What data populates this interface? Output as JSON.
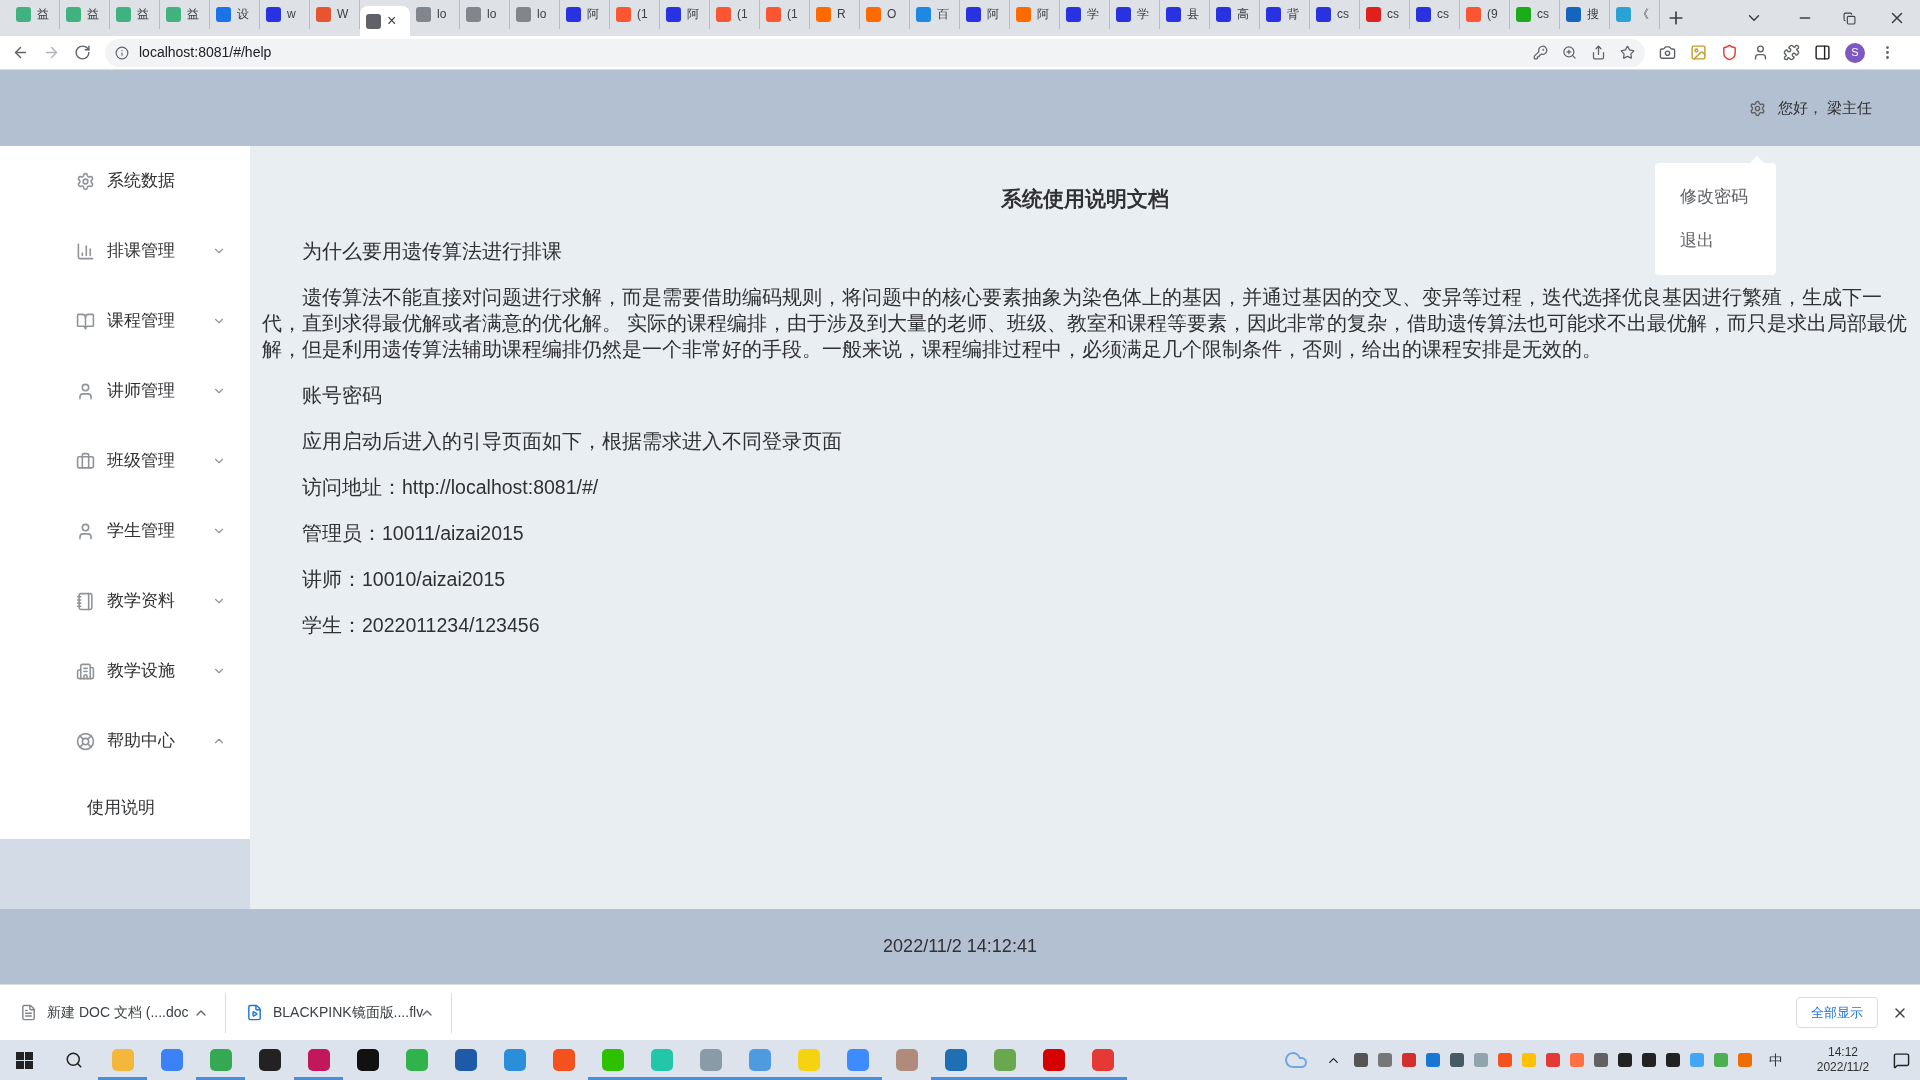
{
  "browser": {
    "tabs": [
      {
        "title": "益",
        "color": "#3fb27f",
        "selected": false
      },
      {
        "title": "益",
        "color": "#3fb27f",
        "selected": false
      },
      {
        "title": "益",
        "color": "#3fb27f",
        "selected": false
      },
      {
        "title": "益",
        "color": "#3fb27f",
        "selected": false
      },
      {
        "title": "设",
        "color": "#1a73e8",
        "selected": false
      },
      {
        "title": "w",
        "color": "#2932e1",
        "selected": false
      },
      {
        "title": "W",
        "color": "#e8542f",
        "selected": false
      },
      {
        "color": "#5f6368",
        "selected": true,
        "close": "×"
      },
      {
        "title": "lo",
        "color": "#80868b",
        "selected": false
      },
      {
        "title": "lo",
        "color": "#80868b",
        "selected": false
      },
      {
        "title": "lo",
        "color": "#80868b",
        "selected": false
      },
      {
        "title": "阿",
        "color": "#2932e1",
        "selected": false
      },
      {
        "title": "(1",
        "color": "#fc5531",
        "selected": false
      },
      {
        "title": "阿",
        "color": "#2932e1",
        "selected": false
      },
      {
        "title": "(1",
        "color": "#fc5531",
        "selected": false
      },
      {
        "title": "(1",
        "color": "#fc5531",
        "selected": false
      },
      {
        "title": "R",
        "color": "#ff6a00",
        "selected": false
      },
      {
        "title": "O",
        "color": "#ff6a00",
        "selected": false
      },
      {
        "title": "百",
        "color": "#1e88e5",
        "selected": false
      },
      {
        "title": "阿",
        "color": "#2932e1",
        "selected": false
      },
      {
        "title": "阿",
        "color": "#ff6a00",
        "selected": false
      },
      {
        "title": "学",
        "color": "#2932e1",
        "selected": false
      },
      {
        "title": "学",
        "color": "#2932e1",
        "selected": false
      },
      {
        "title": "县",
        "color": "#2932e1",
        "selected": false
      },
      {
        "title": "高",
        "color": "#2932e1",
        "selected": false
      },
      {
        "title": "背",
        "color": "#2932e1",
        "selected": false
      },
      {
        "title": "cs",
        "color": "#2932e1",
        "selected": false
      },
      {
        "title": "cs",
        "color": "#e01f1f",
        "selected": false
      },
      {
        "title": "cs",
        "color": "#2932e1",
        "selected": false
      },
      {
        "title": "(9",
        "color": "#fc5531",
        "selected": false
      },
      {
        "title": "cs",
        "color": "#1aad19",
        "selected": false
      },
      {
        "title": "搜",
        "color": "#1565c0",
        "selected": false
      },
      {
        "title": "《",
        "color": "#29a3d6",
        "selected": false
      }
    ],
    "address": "localhost:8081/#/help",
    "profile": "S"
  },
  "header": {
    "greeting": "您好， 梁主任"
  },
  "user_menu": [
    "修改密码",
    "退出"
  ],
  "sidebar": {
    "items": [
      {
        "label": "系统数据",
        "kind": "link"
      },
      {
        "label": "排课管理",
        "kind": "group",
        "expanded": false
      },
      {
        "label": "课程管理",
        "kind": "group",
        "expanded": false
      },
      {
        "label": "讲师管理",
        "kind": "group",
        "expanded": false
      },
      {
        "label": "班级管理",
        "kind": "group",
        "expanded": false
      },
      {
        "label": "学生管理",
        "kind": "group",
        "expanded": false
      },
      {
        "label": "教学资料",
        "kind": "group",
        "expanded": false
      },
      {
        "label": "教学设施",
        "kind": "group",
        "expanded": false
      },
      {
        "label": "帮助中心",
        "kind": "group",
        "expanded": true,
        "children": [
          {
            "label": "使用说明"
          }
        ]
      }
    ]
  },
  "document": {
    "title": "系统使用说明文档",
    "paragraphs": [
      "为什么要用遗传算法进行排课",
      "遗传算法不能直接对问题进行求解，而是需要借助编码规则，将问题中的核心要素抽象为染色体上的基因，并通过基因的交叉、变异等过程，迭代选择优良基因进行繁殖，生成下一代，直到求得最优解或者满意的优化解。 实际的课程编排，由于涉及到大量的老师、班级、教室和课程等要素，因此非常的复杂，借助遗传算法也可能求不出最优解，而只是求出局部最优解，但是利用遗传算法辅助课程编排仍然是一个非常好的手段。一般来说，课程编排过程中，必须满足几个限制条件，否则，给出的课程安排是无效的。",
      "账号密码",
      "应用启动后进入的引导页面如下，根据需求进入不同登录页面",
      "访问地址：http://localhost:8081/#/",
      "管理员：10011/aizai2015",
      "讲师：10010/aizai2015",
      "学生：2022011234/123456"
    ]
  },
  "footer": {
    "time": "2022/11/2 14:12:41"
  },
  "downloads": {
    "items": [
      "新建 DOC 文档 (....doc",
      "BLACKPINK镜面版....flv"
    ],
    "show_all": "全部显示"
  },
  "taskbar": {
    "apps": [
      {
        "color": "#f2b73b",
        "running": true
      },
      {
        "color": "#3b82f6",
        "running": false
      },
      {
        "color": "#34a853",
        "running": true
      },
      {
        "color": "#222222",
        "running": false
      },
      {
        "color": "#c2185b",
        "running": true
      },
      {
        "color": "#111111",
        "running": false
      },
      {
        "color": "#2fb34a",
        "running": false
      },
      {
        "color": "#1e5aa8",
        "running": false
      },
      {
        "color": "#2a8fd8",
        "running": false
      },
      {
        "color": "#f4511e",
        "running": false
      },
      {
        "color": "#2dc100",
        "running": true
      },
      {
        "color": "#21c7a8",
        "running": true
      },
      {
        "color": "#8a9ba8",
        "running": true
      },
      {
        "color": "#4f9be0",
        "running": true
      },
      {
        "color": "#f5d311",
        "running": true
      },
      {
        "color": "#3d8bfd",
        "running": true
      },
      {
        "color": "#b08a7a",
        "running": false
      },
      {
        "color": "#1f6fb5",
        "running": true
      },
      {
        "color": "#6aa84f",
        "running": true
      },
      {
        "color": "#d50000",
        "running": true
      },
      {
        "color": "#e53935",
        "running": true
      }
    ],
    "ime": "中",
    "time": "14:12",
    "date": "2022/11/2"
  }
}
